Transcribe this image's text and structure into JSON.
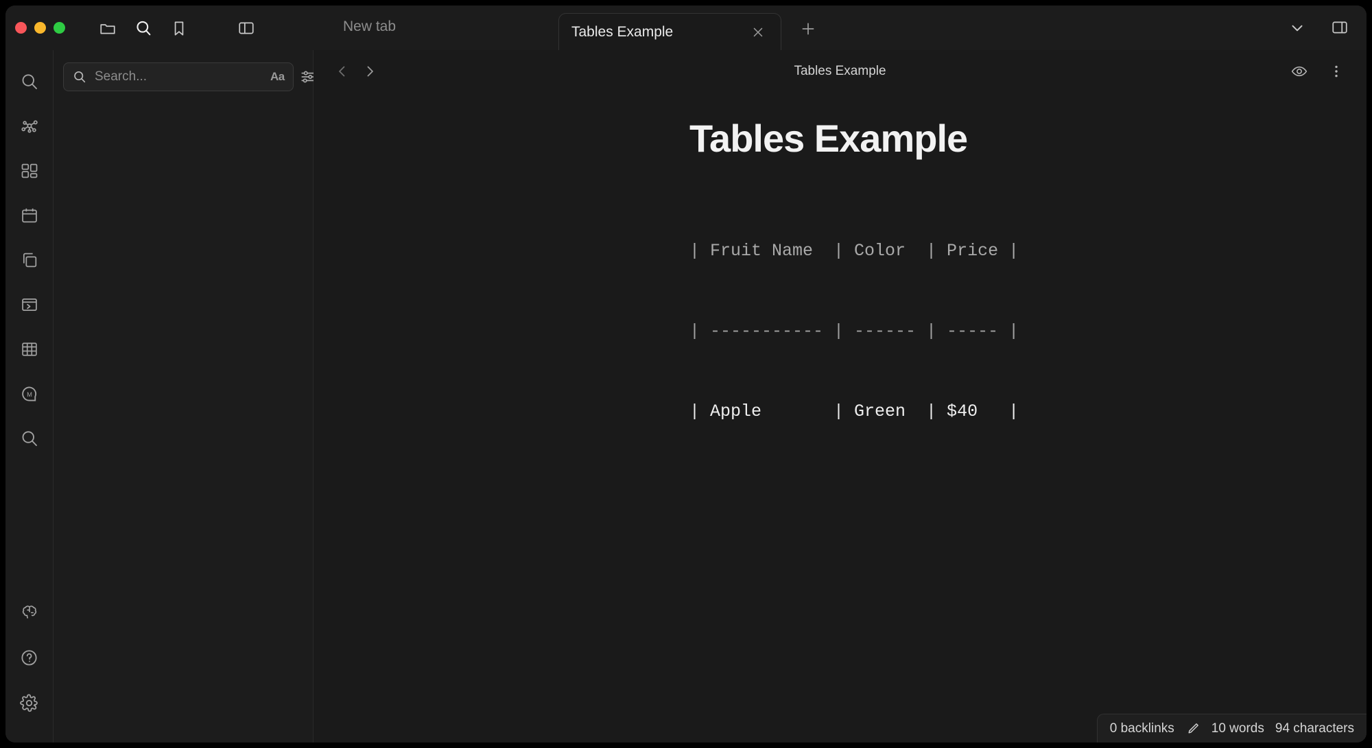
{
  "window": {
    "traffic_lights": [
      "close",
      "minimize",
      "maximize"
    ],
    "colors": {
      "red": "#f8565a",
      "yellow": "#f9b72c",
      "green": "#2ecb43",
      "background": "#1a1a1a",
      "chrome": "#1c1c1c"
    }
  },
  "titlebar": {
    "icons": [
      "folder-icon",
      "search-icon",
      "bookmark-icon",
      "left-sidebar-toggle-icon"
    ],
    "new_tab_label": "New tab",
    "tabs": [
      {
        "label": "Tables Example",
        "active": true,
        "close_label": "×"
      }
    ],
    "new_tab_plus": "+",
    "right_icons": [
      "chevron-down-icon",
      "right-sidebar-toggle-icon"
    ]
  },
  "rail": {
    "items": [
      {
        "name": "search",
        "icon": "search-icon"
      },
      {
        "name": "graph-view",
        "icon": "graph-icon"
      },
      {
        "name": "blocks",
        "icon": "blocks-icon"
      },
      {
        "name": "calendar",
        "icon": "calendar-icon"
      },
      {
        "name": "layers",
        "icon": "layers-icon"
      },
      {
        "name": "console",
        "icon": "terminal-window-icon"
      },
      {
        "name": "table",
        "icon": "table-icon"
      },
      {
        "name": "mermaid",
        "icon": "m-circle-icon"
      },
      {
        "name": "omnisearch",
        "icon": "search-icon"
      }
    ],
    "bottom_items": [
      {
        "name": "smart-connections",
        "icon": "brain-icon"
      },
      {
        "name": "help",
        "icon": "question-circle-icon"
      },
      {
        "name": "settings",
        "icon": "gear-icon"
      }
    ]
  },
  "search_panel": {
    "placeholder": "Search...",
    "value": "",
    "match_case_label": "Aa",
    "filter_icon": "sliders-icon",
    "search_icon": "search-icon"
  },
  "main": {
    "back_label": "‹",
    "forward_label": "›",
    "breadcrumb": "Tables Example",
    "right_icons": [
      "eye-icon",
      "more-vertical-icon"
    ]
  },
  "document": {
    "title": "Tables Example",
    "table_lines": [
      "| Fruit Name  | Color  | Price |",
      "| ----------- | ------ | ----- |",
      "| Apple       | Green  | $40   |"
    ],
    "table": {
      "headers": [
        "Fruit Name",
        "Color",
        "Price"
      ],
      "rows": [
        [
          "Apple",
          "Green",
          "$40"
        ]
      ]
    }
  },
  "statusbar": {
    "backlinks": "0 backlinks",
    "pencil_icon": "pencil-icon",
    "words": "10 words",
    "characters": "94 characters"
  }
}
